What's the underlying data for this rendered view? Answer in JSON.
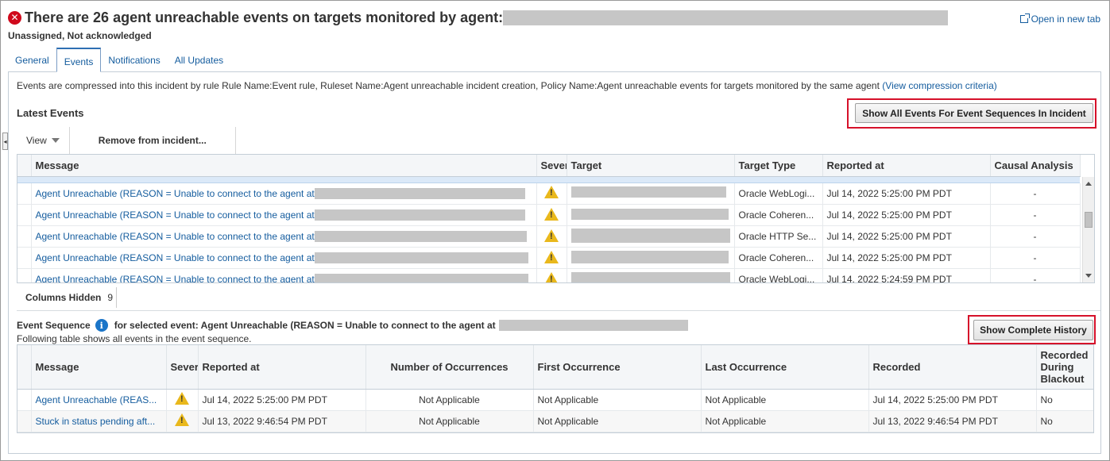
{
  "header": {
    "title": "There are 26 agent unreachable events on targets monitored by agent:",
    "status": "Unassigned, Not acknowledged",
    "open_new_tab": "Open in new tab"
  },
  "tabs": [
    {
      "label": "General",
      "active": false
    },
    {
      "label": "Events",
      "active": true
    },
    {
      "label": "Notifications",
      "active": false
    },
    {
      "label": "All Updates",
      "active": false
    }
  ],
  "compression": {
    "text": "Events are compressed into this incident by rule Rule Name:Event rule, Ruleset Name:Agent unreachable incident creation, Policy Name:Agent unreachable events for targets monitored by the same agent",
    "link": "(View compression criteria)"
  },
  "latest_events": {
    "title": "Latest Events",
    "show_all_button": "Show All Events For Event Sequences In Incident",
    "toolbar": {
      "view": "View",
      "remove": "Remove from incident..."
    },
    "columns": [
      "Message",
      "Severity",
      "Target",
      "Target Type",
      "Reported at",
      "Causal Analysis"
    ],
    "rows": [
      {
        "message": "Agent Unreachable (REASON = Unable to connect to the agent at",
        "severity": "warning",
        "target_type": "Oracle WebLogi...",
        "reported": "Jul 14, 2022 5:25:00 PM PDT",
        "causal": "-"
      },
      {
        "message": "Agent Unreachable (REASON = Unable to connect to the agent at",
        "severity": "warning",
        "target_type": "Oracle Coheren...",
        "reported": "Jul 14, 2022 5:25:00 PM PDT",
        "causal": "-"
      },
      {
        "message": "Agent Unreachable (REASON = Unable to connect to the agent at",
        "severity": "warning",
        "target_type": "Oracle HTTP Se...",
        "reported": "Jul 14, 2022 5:25:00 PM PDT",
        "causal": "-"
      },
      {
        "message": "Agent Unreachable (REASON = Unable to connect to the agent at",
        "severity": "warning",
        "target_type": "Oracle Coheren...",
        "reported": "Jul 14, 2022 5:25:00 PM PDT",
        "causal": "-"
      },
      {
        "message": "Agent Unreachable (REASON = Unable to connect to the agent at",
        "severity": "warning",
        "target_type": "Oracle WebLogi...",
        "reported": "Jul 14, 2022 5:24:59 PM PDT",
        "causal": "-"
      }
    ],
    "columns_hidden_label": "Columns Hidden",
    "columns_hidden_count": "9"
  },
  "event_sequence": {
    "title": "Event Sequence",
    "for_selected": "for selected event: Agent Unreachable (REASON = Unable to connect to the agent at",
    "subtitle": "Following table shows all events in the event sequence.",
    "history_button": "Show Complete History",
    "columns": [
      "Message",
      "Severity",
      "Reported at",
      "Number of Occurrences",
      "First Occurrence",
      "Last Occurrence",
      "Recorded",
      "Recorded During Blackout"
    ],
    "rows": [
      {
        "message": "Agent Unreachable (REAS...",
        "severity": "warning",
        "reported": "Jul 14, 2022 5:25:00 PM PDT",
        "occurrences": "Not Applicable",
        "first": "Not Applicable",
        "last": "Not Applicable",
        "recorded": "Jul 14, 2022 5:25:00 PM PDT",
        "blackout": "No"
      },
      {
        "message": "Stuck in status pending aft...",
        "severity": "warning",
        "reported": "Jul 13, 2022 9:46:54 PM PDT",
        "occurrences": "Not Applicable",
        "first": "Not Applicable",
        "last": "Not Applicable",
        "recorded": "Jul 13, 2022 9:46:54 PM PDT",
        "blackout": "No"
      }
    ]
  },
  "colors": {
    "link": "#145c9e",
    "error": "#d0091c",
    "warning": "#e9b81c",
    "highlight": "#d6112a",
    "info": "#1b75c8"
  }
}
